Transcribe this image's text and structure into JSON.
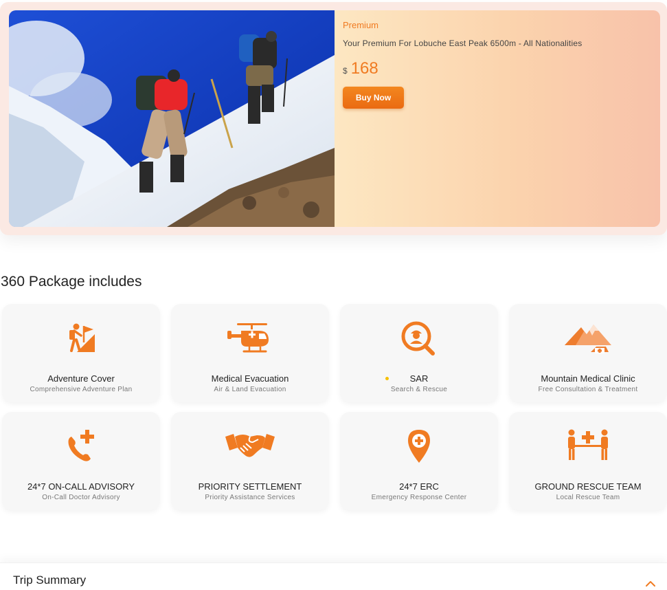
{
  "premium": {
    "tag": "Premium",
    "title": "Your Premium For Lobuche East Peak 6500m - All Nationalities",
    "currency": "$",
    "price": "168",
    "buy_label": "Buy Now",
    "accent": "#f07b22"
  },
  "package": {
    "title": "360 Package includes",
    "items": [
      {
        "icon": "hiker-flag-icon",
        "title": "Adventure Cover",
        "subtitle": "Comprehensive Adventure Plan"
      },
      {
        "icon": "helicopter-icon",
        "title": "Medical Evacuation",
        "subtitle": "Air & Land Evacuation"
      },
      {
        "icon": "search-rescuer-icon",
        "title": "SAR",
        "subtitle": "Search & Rescue"
      },
      {
        "icon": "mountain-clinic-icon",
        "title": "Mountain Medical Clinic",
        "subtitle": "Free Consultation & Treatment"
      },
      {
        "icon": "phone-plus-icon",
        "title": "24*7 ON-CALL ADVISORY",
        "subtitle": "On-Call Doctor Advisory"
      },
      {
        "icon": "handshake-icon",
        "title": "PRIORITY SETTLEMENT",
        "subtitle": "Priority Assistance Services"
      },
      {
        "icon": "location-cross-icon",
        "title": "24*7 ERC",
        "subtitle": "Emergency Response Center"
      },
      {
        "icon": "stretcher-team-icon",
        "title": "GROUND RESCUE TEAM",
        "subtitle": "Local Rescue Team"
      }
    ]
  },
  "trip_summary": {
    "title": "Trip Summary",
    "expanded": true
  }
}
